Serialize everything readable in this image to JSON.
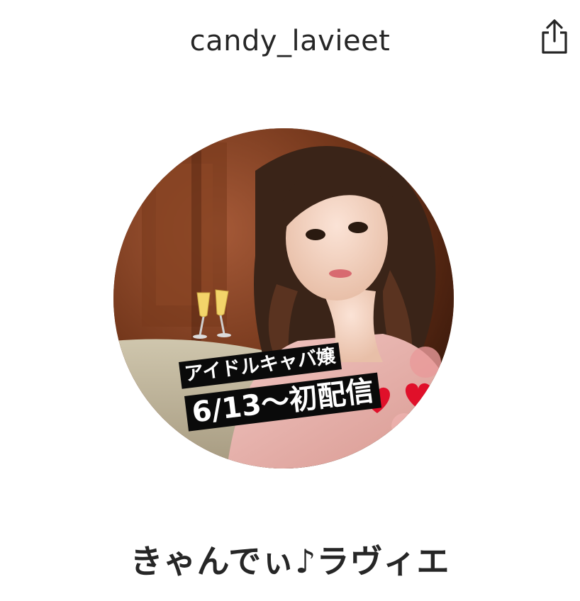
{
  "header": {
    "username": "candy_lavieet",
    "share_icon": "share-icon"
  },
  "profile": {
    "avatar_caption_line1": "アイドルキャバ嬢",
    "avatar_caption_line2": "6/13〜初配信",
    "display_name": "きゃんでぃ♪ラヴィエ"
  },
  "colors": {
    "text": "#262626",
    "background": "#ffffff",
    "caption_bg": "#0a0a0a",
    "heart": "#e0102a"
  }
}
